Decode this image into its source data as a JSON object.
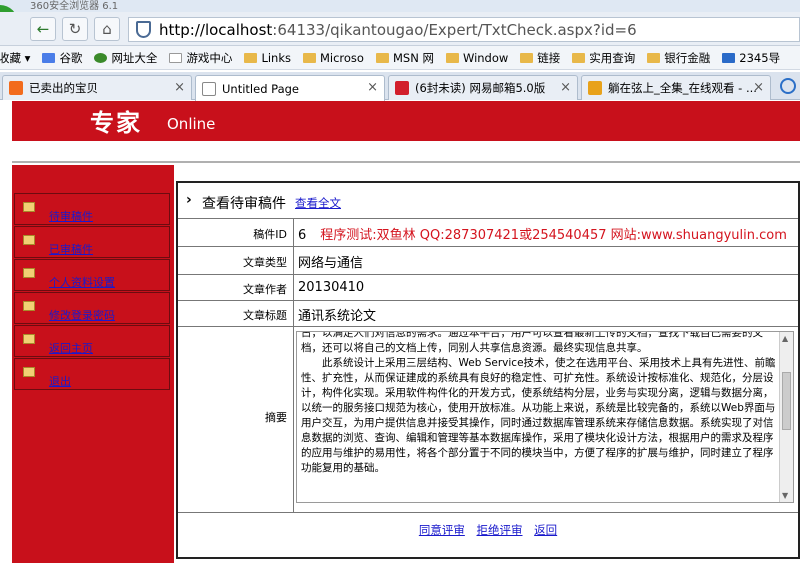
{
  "browser": {
    "window_title": "360安全浏览器 6.1",
    "url_host": "http://localhost",
    "url_rest": ":64133/qikantougao/Expert/TxtCheck.aspx?id=6",
    "favorites": [
      "收藏",
      "谷歌",
      "网址大全",
      "游戏中心",
      "Links",
      "Microso",
      "MSN 网",
      "Window",
      "链接",
      "实用查询",
      "银行金融",
      "2345导"
    ],
    "tabs": [
      {
        "label": "已卖出的宝贝",
        "active": false
      },
      {
        "label": "Untitled Page",
        "active": true
      },
      {
        "label": "(6封未读) 网易邮箱5.0版",
        "active": false
      },
      {
        "label": "躺在弦上_全集_在线观看 - ...",
        "active": false
      }
    ]
  },
  "header": {
    "title": "专家",
    "subtitle": "Online"
  },
  "sidebar": {
    "items": [
      "待审稿件",
      "已审稿件",
      "个人资料设置",
      "修改登录密码",
      "返回主页",
      "退出"
    ]
  },
  "review": {
    "heading": "查看待审稿件",
    "view_full": "查看全文",
    "fields": {
      "id_label": "稿件ID",
      "id_value": "6",
      "promo": "程序测试:双鱼林 QQ:287307421或254540457 网站:www.shuangyulin.com",
      "type_label": "文章类型",
      "type_value": "网络与通信",
      "author_label": "文章作者",
      "author_value": "20130410",
      "title_label": "文章标题",
      "title_value": "通讯系统论文",
      "abstract_label": "摘要"
    },
    "abstract_lines": [
      "占，以满足人们对信息的需求。通过本平台，用户可以查看最新上传的文档，查找下载自己需要的文档，还可以将自己的文档上传，同别人共享信息资源。最终实现信息共享。",
      "此系统设计上采用三层结构、Web Service技术，使之在选用平台、采用技术上具有先进性、前瞻性、扩充性，从而保证建成的系统具有良好的稳定性、可扩充性。系统设计按标准化、规范化，分层设计，构件化实现。采用软件构件化的开发方式，使系统结构分层，业务与实现分离，逻辑与数据分离，以统一的服务接口规范为核心，使用开放标准。从功能上来说，系统是比较完备的，系统以Web界面与用户交互，为用户提供信息并接受其操作，同时通过数据库管理系统来存储信息数据。系统实现了对信息数据的浏览、查询、编辑和管理等基本数据库操作，采用了模块化设计方法，根据用户的需求及程序的应用与维护的易用性，将各个部分置于不同的模块当中，方便了程序的扩展与维护，同时建立了程序功能复用的基础。"
    ],
    "actions": {
      "approve": "同意评审",
      "reject": "拒绝评审",
      "back": "返回"
    }
  }
}
